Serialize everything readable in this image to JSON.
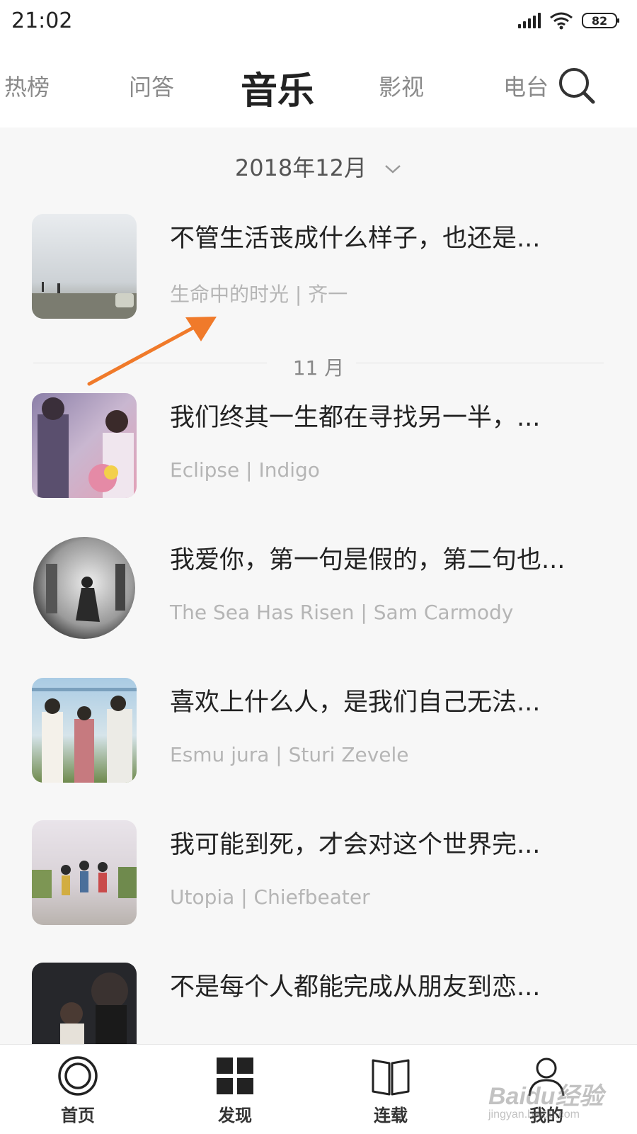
{
  "status_bar": {
    "time": "21:02",
    "battery": "82"
  },
  "tabs": [
    {
      "label": "热榜"
    },
    {
      "label": "问答"
    },
    {
      "label": "音乐",
      "active": true
    },
    {
      "label": "影视"
    },
    {
      "label": "电台"
    }
  ],
  "month_selector": {
    "label": "2018年12月"
  },
  "section_divider": {
    "label": "11 月"
  },
  "items": [
    {
      "title": "不管生活丧成什么样子，也还是...",
      "subtitle": "生命中的时光 | 齐一"
    },
    {
      "title": "我们终其一生都在寻找另一半，...",
      "subtitle": "Eclipse | Indigo"
    },
    {
      "title": "我爱你，第一句是假的，第二句也...",
      "subtitle": "The Sea Has Risen | Sam Carmody"
    },
    {
      "title": "喜欢上什么人，是我们自己无法...",
      "subtitle": "Esmu jura | Sturi Zevele"
    },
    {
      "title": "我可能到死，才会对这个世界完...",
      "subtitle": "Utopia | Chiefbeater"
    },
    {
      "title": "不是每个人都能完成从朋友到恋...",
      "subtitle": ""
    }
  ],
  "bottom_nav": [
    {
      "label": "首页",
      "icon": "home-ring-icon"
    },
    {
      "label": "发现",
      "icon": "grid-icon"
    },
    {
      "label": "连载",
      "icon": "book-icon"
    },
    {
      "label": "我的",
      "icon": "user-icon"
    }
  ],
  "watermark": {
    "line1": "Baidu经验",
    "line2": "jingyan.baidu.com"
  },
  "colors": {
    "annotation_arrow": "#f07a2a",
    "active_tab": "#222222",
    "subtitle": "#b5b5b5"
  }
}
